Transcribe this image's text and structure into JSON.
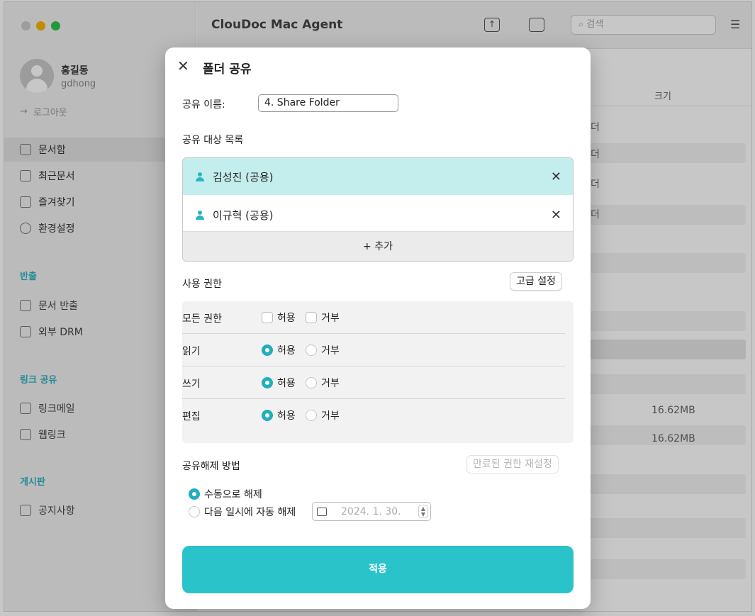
{
  "window": {
    "app_title": "ClouDoc Mac Agent",
    "search_placeholder": "검색",
    "traffic_colors": [
      "#c9c9c9",
      "#f7b500",
      "#2cc54a"
    ]
  },
  "sidebar": {
    "user_name": "홍길동",
    "user_id": "gdhong",
    "logout_label": "로그아웃",
    "items": [
      {
        "label": "문서함",
        "active": true
      },
      {
        "label": "최근문서"
      },
      {
        "label": "즐겨찾기"
      },
      {
        "label": "환경설정"
      }
    ],
    "sections": [
      {
        "title": "반출",
        "items": [
          {
            "label": "문서 반출"
          },
          {
            "label": "외부 DRM"
          }
        ]
      },
      {
        "title": "링크 공유",
        "items": [
          {
            "label": "링크메일"
          },
          {
            "label": "웹링크"
          }
        ]
      },
      {
        "title": "게시판",
        "items": [
          {
            "label": "공지사항"
          }
        ]
      }
    ]
  },
  "content": {
    "size_header": "크기",
    "rows": [
      {
        "type_fragment": "더"
      },
      {
        "type_fragment": "더"
      },
      {
        "type_fragment": "더"
      },
      {
        "type_fragment": "더"
      },
      {
        "size": "16.62MB"
      },
      {
        "size": "16.62MB"
      }
    ]
  },
  "dialog": {
    "title": "폴더 공유",
    "share_name_label": "공유 이름:",
    "share_name_value": "4. Share Folder",
    "targets_label": "공유 대상 목록",
    "targets": [
      {
        "name": "김성진 (공용)",
        "selected": true
      },
      {
        "name": "이규혁 (공용)",
        "selected": false
      }
    ],
    "add_label": "+ 추가",
    "permissions_label": "사용 권한",
    "advanced_button": "고급 설정",
    "allow_label": "허용",
    "deny_label": "거부",
    "permissions": [
      {
        "name": "모든 권한",
        "control": "checkbox",
        "allow": false,
        "deny": false
      },
      {
        "name": "읽기",
        "control": "radio",
        "allow": true,
        "deny": false
      },
      {
        "name": "쓰기",
        "control": "radio",
        "allow": true,
        "deny": false
      },
      {
        "name": "편집",
        "control": "radio",
        "allow": true,
        "deny": false
      }
    ],
    "unshare_label": "공유해제 방법",
    "reset_expired_button": "만료된 권한 재설정",
    "unshare_manual": "수동으로 해제",
    "unshare_auto": "다음 일시에 자동 해제",
    "unshare_selected": "manual",
    "auto_date": "2024.  1. 30.",
    "apply_button": "적용",
    "accent_color": "#29c3c9"
  }
}
